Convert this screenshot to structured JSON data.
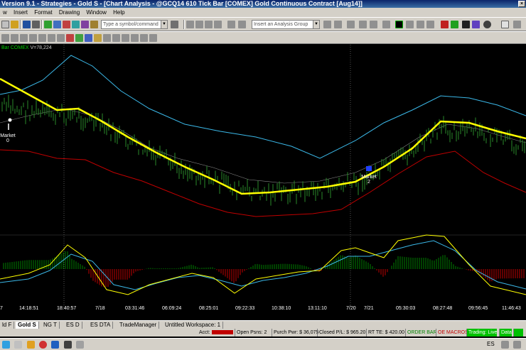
{
  "window": {
    "title": "Version 9.1 - Strategies - Gold S - [Chart Analysis - @GCQ14 610 Tick Bar [COMEX] Gold Continuous Contract [Aug14]]"
  },
  "menu": [
    "w",
    "Insert",
    "Format",
    "Drawing",
    "Window",
    "Help"
  ],
  "toolbar": {
    "symbol_placeholder": "Type a symbol/command",
    "analysis_placeholder": "Insert an Analysis Group"
  },
  "chart": {
    "info_prefix": "Bar",
    "exchange": "COMEX",
    "volume_label": "V=78,224",
    "time_labels": [
      "7",
      "14:18:51",
      "18:40:57",
      "7/18",
      "03:31:46",
      "06:09:24",
      "08:25:01",
      "09:22:33",
      "10:38:10",
      "13:11:10",
      "7/20",
      "7/21",
      "05:30:03",
      "08:27:48",
      "09:56:45",
      "11:46:43"
    ],
    "markers": [
      {
        "label": "Market",
        "sub": "0"
      },
      {
        "label": "Market",
        "sub": "2"
      }
    ]
  },
  "tabs": [
    "ld F",
    "Gold S",
    "NG T",
    "ES D",
    "ES DTA",
    "TradeManager",
    "Untitled Workspace: 1"
  ],
  "status": {
    "acct_label": "Acct:",
    "open_psns": "Open Psns: 2",
    "purch_pwr": "Purch Pwr: $ 36,075",
    "closed_pl": "Closed P/L: $ 965.20",
    "rt_te": "RT TE: $ 420.00",
    "order_bar": "ORDER BAR",
    "oe_macros": "OE MACROS",
    "trading": "Trading: Live",
    "data": "Data"
  },
  "taskbar": {
    "lang": "ES"
  },
  "colors": {
    "upper_band": "#3bb8e8",
    "lower_band": "#c00000",
    "middle": "#ffff00",
    "price": "#2a8a2a",
    "osc_fast": "#ffff00",
    "osc_slow": "#3bb8e8",
    "hist_up": "#008000",
    "hist_down": "#c00000"
  }
}
